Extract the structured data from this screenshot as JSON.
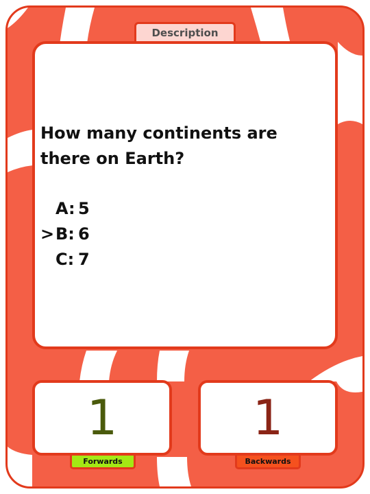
{
  "card": {
    "description_tab": "Description",
    "question": "How many continents are there on Earth?",
    "answers": [
      {
        "marker": "",
        "letter": "A:",
        "value": "5"
      },
      {
        "marker": ">",
        "letter": "B:",
        "value": "6"
      },
      {
        "marker": "",
        "letter": "C:",
        "value": "7"
      }
    ],
    "selected_answer": "B"
  },
  "counters": {
    "forwards": {
      "value": "1",
      "label": "Forwards"
    },
    "backwards": {
      "value": "1",
      "label": "Backwards"
    }
  },
  "colors": {
    "card_red": "#f45f46",
    "border_red": "#e23a1c",
    "forwards_label_bg": "#a4e814",
    "backwards_label_bg": "#f5511e",
    "forwards_number": "#4a5a0c",
    "backwards_number": "#8a2416"
  }
}
